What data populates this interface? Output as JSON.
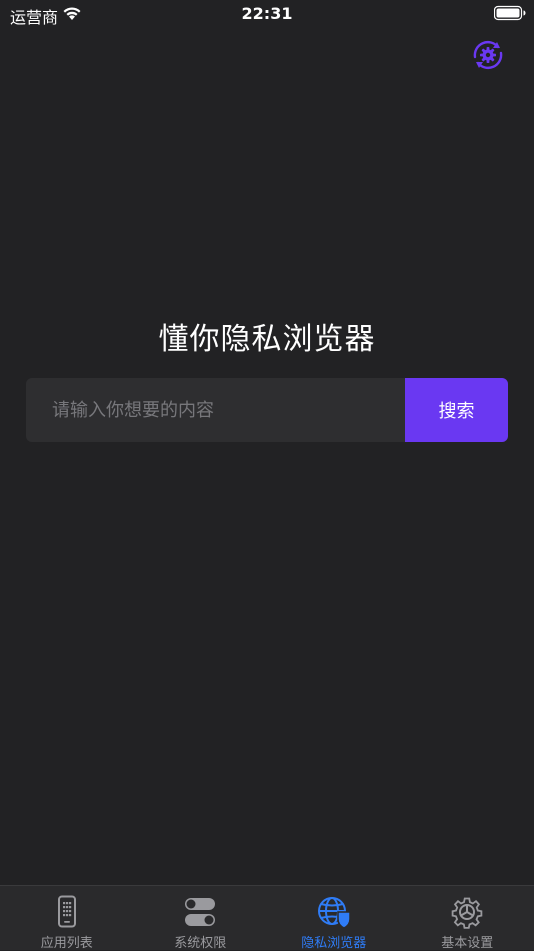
{
  "status_bar": {
    "carrier": "运营商",
    "time": "22:31",
    "icons": [
      "wifi-icon",
      "battery-icon"
    ]
  },
  "header": {
    "action_icon": "refresh-settings-icon",
    "accent_color": "#6a38f2"
  },
  "main": {
    "title": "懂你隐私浏览器",
    "search": {
      "placeholder": "请输入你想要的内容",
      "value": "",
      "button_label": "搜索"
    }
  },
  "tab_bar": {
    "active_color": "#2f7cf6",
    "inactive_color": "#9a9a9e",
    "tabs": [
      {
        "label": "应用列表",
        "icon": "phone-grid-icon",
        "active": false
      },
      {
        "label": "系统权限",
        "icon": "toggle-switches-icon",
        "active": false
      },
      {
        "label": "隐私浏览器",
        "icon": "globe-shield-icon",
        "active": true
      },
      {
        "label": "基本设置",
        "icon": "gear-icon",
        "active": false
      }
    ]
  }
}
